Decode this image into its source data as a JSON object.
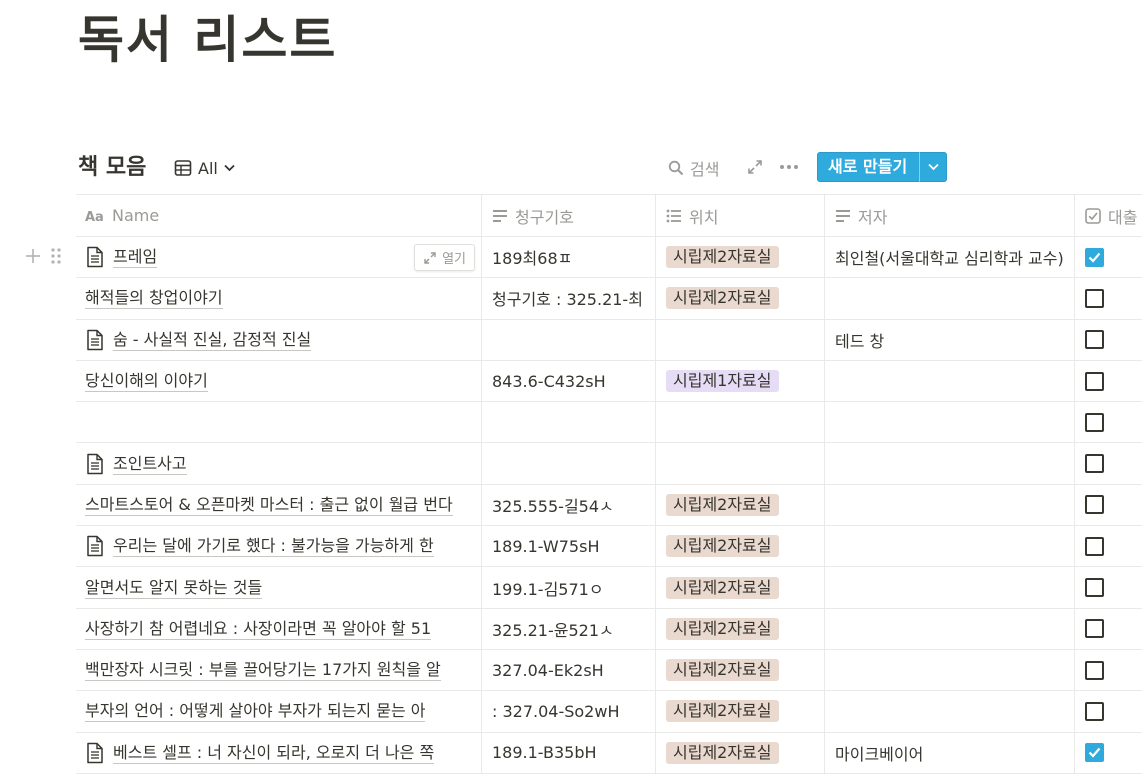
{
  "page": {
    "title": "독서 리스트"
  },
  "database": {
    "title": "책 모음",
    "view_label": "All",
    "search_label": "검색",
    "new_button_label": "새로 만들기"
  },
  "columns": [
    {
      "label": "Name",
      "icon": "text-aa-icon"
    },
    {
      "label": "청구기호",
      "icon": "text-lines-icon"
    },
    {
      "label": "위치",
      "icon": "list-icon"
    },
    {
      "label": "저자",
      "icon": "text-lines-icon"
    },
    {
      "label": "대출",
      "icon": "checkbox-icon"
    }
  ],
  "row_hover": {
    "open_label": "열기"
  },
  "colors": {
    "accent": "#2eaadc",
    "tag_brown": "#e9d9cf",
    "tag_purple": "#e6dcf6",
    "text": "#37352f",
    "muted": "#9b9a97"
  },
  "rows": [
    {
      "name": "프레임",
      "has_icon": true,
      "call_no": "189최68ㅍ",
      "location": "시립제2자료실",
      "loc_color": "brown",
      "author": "최인철(서울대학교 심리학과 교수)",
      "loaned": true
    },
    {
      "name": "해적들의 창업이야기",
      "has_icon": false,
      "call_no": "청구기호 : 325.21-최",
      "location": "시립제2자료실",
      "loc_color": "brown",
      "author": "",
      "loaned": false
    },
    {
      "name": "숨 - 사실적 진실, 감정적 진실",
      "has_icon": true,
      "call_no": "",
      "location": "",
      "loc_color": "",
      "author": "테드 창",
      "loaned": false
    },
    {
      "name": "당신이해의 이야기",
      "has_icon": false,
      "call_no": "843.6-C432sH",
      "location": "시립제1자료실",
      "loc_color": "purple",
      "author": "",
      "loaned": false
    },
    {
      "name": "",
      "has_icon": false,
      "call_no": "",
      "location": "",
      "loc_color": "",
      "author": "",
      "loaned": false
    },
    {
      "name": "조인트사고",
      "has_icon": true,
      "call_no": "",
      "location": "",
      "loc_color": "",
      "author": "",
      "loaned": false
    },
    {
      "name": "스마트스토어 & 오픈마켓 마스터 : 출근 없이 월급 번다",
      "has_icon": false,
      "call_no": "325.555-길54ㅅ",
      "location": "시립제2자료실",
      "loc_color": "brown",
      "author": "",
      "loaned": false
    },
    {
      "name": "우리는 달에 가기로 했다 : 불가능을 가능하게 한",
      "has_icon": true,
      "call_no": "189.1-W75sH",
      "location": "시립제2자료실",
      "loc_color": "brown",
      "author": "",
      "loaned": false
    },
    {
      "name": "알면서도 알지 못하는 것들",
      "has_icon": false,
      "call_no": "199.1-김571ㅇ",
      "location": "시립제2자료실",
      "loc_color": "brown",
      "author": "",
      "loaned": false
    },
    {
      "name": "사장하기 참 어렵네요 : 사장이라면 꼭 알아야 할 51",
      "has_icon": false,
      "call_no": "325.21-윤521ㅅ",
      "location": "시립제2자료실",
      "loc_color": "brown",
      "author": "",
      "loaned": false
    },
    {
      "name": "백만장자 시크릿 : 부를 끌어당기는 17가지 원칙을 알",
      "has_icon": false,
      "call_no": "327.04-Ek2sH",
      "location": "시립제2자료실",
      "loc_color": "brown",
      "author": "",
      "loaned": false
    },
    {
      "name": "부자의 언어 : 어떻게 살아야 부자가 되는지 묻는 아",
      "has_icon": false,
      "call_no": ": 327.04-So2wH",
      "location": "시립제2자료실",
      "loc_color": "brown",
      "author": "",
      "loaned": false
    },
    {
      "name": "베스트 셀프 : 너 자신이 되라, 오로지 더 나은 쪽",
      "has_icon": true,
      "call_no": "189.1-B35bH",
      "location": "시립제2자료실",
      "loc_color": "brown",
      "author": "마이크베이어",
      "loaned": true
    }
  ]
}
